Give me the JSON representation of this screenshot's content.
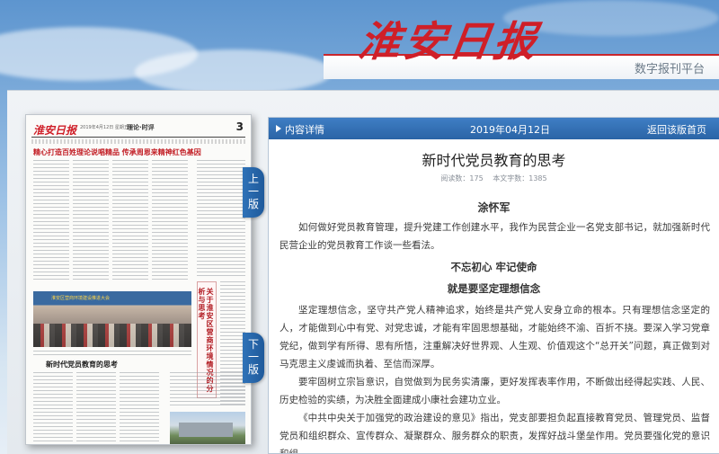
{
  "header": {
    "masthead": "淮安日报",
    "platform": "数字报刊平台"
  },
  "paper": {
    "logo": "淮安日报",
    "meta": "2019年4月12日 星期五",
    "section": "理论·时评",
    "page_number": "3",
    "headline": "精心打造百姓理论说唱精品 传承周恩来精神红色基因",
    "side_title": "关于淮安区营商环境情况的分析与思考",
    "photo_banner": "淮安区营商环境建设推进大会",
    "article_title": "新时代党员教育的思考"
  },
  "nav": {
    "prev_label": [
      "上",
      "一",
      "版"
    ],
    "next_label": [
      "下",
      "一",
      "版"
    ]
  },
  "panel": {
    "label": "内容详情",
    "date": "2019年04月12日",
    "back": "返回该版首页"
  },
  "article": {
    "title": "新时代党员教育的思考",
    "reads_label": "阅读数：175",
    "words_label": "本文字数：1385",
    "author": "涂怀军",
    "intro": "如何做好党员教育管理，提升党建工作创建水平，我作为民营企业一名党支部书记，就加强新时代民营企业的党员教育工作谈一些看法。",
    "subhead1": "不忘初心 牢记使命",
    "subhead2": "就是要坚定理想信念",
    "p1": "坚定理想信念，坚守共产党人精神追求，始终是共产党人安身立命的根本。只有理想信念坚定的人，才能做到心中有党、对党忠诚，才能有牢固思想基础，才能始终不渝、百折不挠。要深入学习党章党纪，做到学有所得、思有所悟，注重解决好世界观、人生观、价值观这个“总开关”问题，真正做到对马克思主义虔诚而执着、至信而深厚。",
    "p2": "要牢固树立宗旨意识，自觉做到为民务实清廉，更好发挥表率作用，不断做出经得起实践、人民、历史检验的实绩，为决胜全面建成小康社会建功立业。",
    "p3": "《中共中央关于加强党的政治建设的意见》指出，党支部要担负起直接教育党员、管理党员、监督党员和组织群众、宣传群众、凝聚群众、服务群众的职责，发挥好战斗堡垒作用。党员要强化党的意识和组"
  },
  "colors": {
    "masthead_red": "#cf1f28",
    "bar_blue": "#2a64a6",
    "tab_blue": "#2f72b8"
  }
}
